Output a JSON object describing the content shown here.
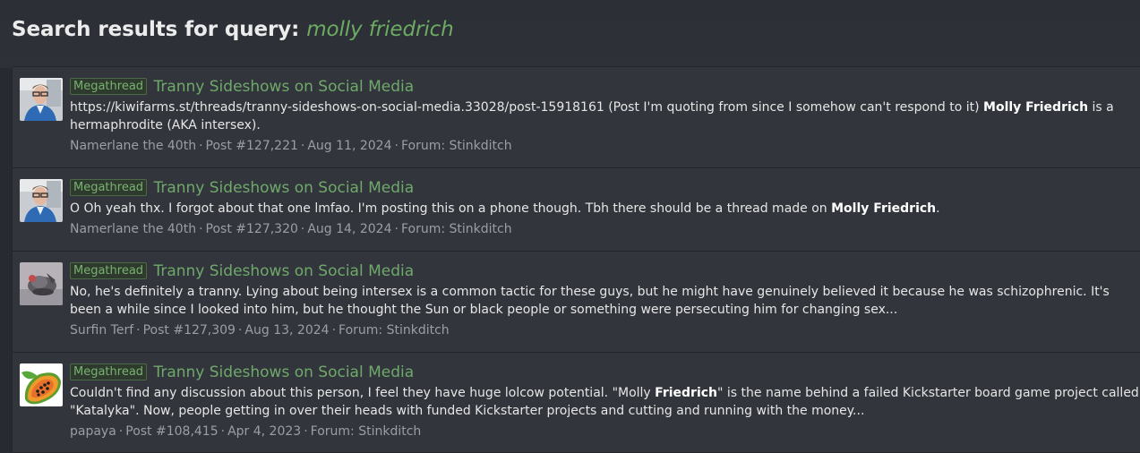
{
  "header": {
    "title_prefix": "Search results for query:",
    "query": "molly friedrich"
  },
  "results": [
    {
      "avatar": "man-with-glasses-avatar",
      "label": "Megathread",
      "thread_title": "Tranny Sideshows on Social Media",
      "snippet_before": "https://kiwifarms.st/threads/tranny-sideshows-on-social-media.33028/post-15918161 (Post I'm quoting from since I somehow can't respond to it) ",
      "snippet_highlight": "Molly Friedrich",
      "snippet_after": " is a hermaphrodite (AKA intersex).",
      "author": "Namerlane the 40th",
      "post": "Post #127,221",
      "date": "Aug 11, 2024",
      "forum": "Forum: Stinkditch"
    },
    {
      "avatar": "man-with-glasses-avatar",
      "label": "Megathread",
      "thread_title": "Tranny Sideshows on Social Media",
      "snippet_before": "O Oh yeah thx. I forgot about that one lmfao. I'm posting this on a phone though. Tbh there should be a thread made on ",
      "snippet_highlight": "Molly Friedrich",
      "snippet_after": ".",
      "author": "Namerlane the 40th",
      "post": "Post #127,320",
      "date": "Aug 14, 2024",
      "forum": "Forum: Stinkditch"
    },
    {
      "avatar": "sculpture-photo-avatar",
      "label": "Megathread",
      "thread_title": "Tranny Sideshows on Social Media",
      "snippet_before": "No, he's definitely a tranny. Lying about being intersex is a common tactic for these guys, but he might have genuinely believed it because he was schizophrenic. It's been a while since I looked into him, but he thought the Sun or black people or something were persecuting him for changing sex...",
      "snippet_highlight": "",
      "snippet_after": "",
      "author": "Surfin Terf",
      "post": "Post #127,309",
      "date": "Aug 13, 2024",
      "forum": "Forum: Stinkditch"
    },
    {
      "avatar": "papaya-avatar",
      "label": "Megathread",
      "thread_title": "Tranny Sideshows on Social Media",
      "snippet_before": "Couldn't find any discussion about this person, I feel they have huge lolcow potential. \"Molly ",
      "snippet_highlight": "Friedrich",
      "snippet_after": "\" is the name behind a failed Kickstarter board game project called \"Katalyka\". Now, people getting in over their heads with funded Kickstarter projects and cutting and running with the money...",
      "author": "papaya",
      "post": "Post #108,415",
      "date": "Apr 4, 2023",
      "forum": "Forum: Stinkditch"
    }
  ]
}
